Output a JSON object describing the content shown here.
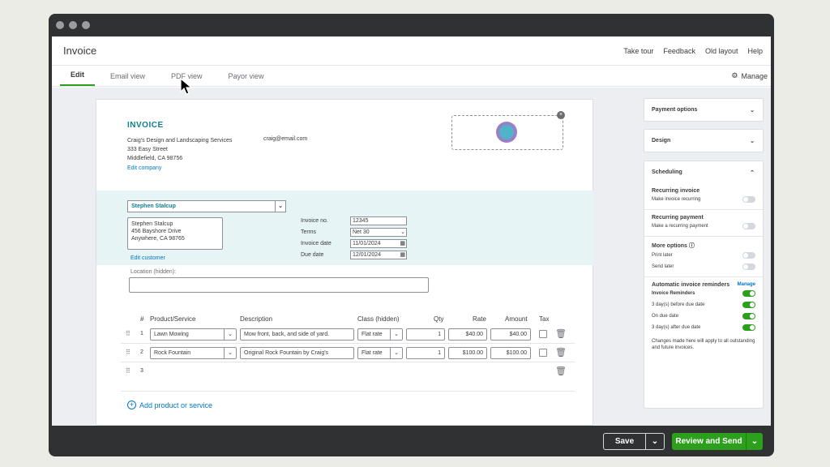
{
  "header": {
    "title": "Invoice",
    "links": [
      "Take tour",
      "Feedback",
      "Old layout",
      "Help"
    ]
  },
  "tabs": [
    "Edit",
    "Email view",
    "PDF view",
    "Payor view"
  ],
  "manage_label": "Manage",
  "invoice": {
    "heading": "INVOICE",
    "company_lines": [
      "Craig's Design and Landscaping Services",
      "333 Easy Street",
      "Middlefield, CA 98756"
    ],
    "email": "craig@email.com",
    "edit_company": "Edit company",
    "customer": "Stephen Stalcup",
    "billing_lines": [
      "Stephen Stalcup",
      "456 Bayshore Drive",
      "Anywhere, CA 98765"
    ],
    "edit_customer": "Edit customer",
    "meta": {
      "invoice_no_label": "Invoice no.",
      "invoice_no": "12345",
      "terms_label": "Terms",
      "terms": "Net 30",
      "invoice_date_label": "Invoice date",
      "invoice_date": "11/01/2024",
      "due_date_label": "Due date",
      "due_date": "12/01/2024"
    },
    "location_label": "Location (hidden):",
    "columns": [
      "#",
      "Product/Service",
      "Description",
      "Class (hidden)",
      "Qty",
      "Rate",
      "Amount",
      "Tax"
    ],
    "lines": [
      {
        "num": "1",
        "product": "Lawn Mowing",
        "description": "Mow front, back, and side of yard.",
        "class": "Flat rate",
        "qty": "1",
        "rate": "$40.00",
        "amount": "$40.00"
      },
      {
        "num": "2",
        "product": "Rock Fountain",
        "description": "Original Rock Fountain by Craig's",
        "class": "Flat rate",
        "qty": "1",
        "rate": "$100.00",
        "amount": "$100.00"
      },
      {
        "num": "3"
      }
    ],
    "add_line": "Add product or service"
  },
  "sidebar": {
    "payment_options": "Payment options",
    "design": "Design",
    "scheduling": "Scheduling",
    "recurring_invoice_title": "Recurring invoice",
    "recurring_invoice_toggle": "Make invoice recurring",
    "recurring_payment_title": "Recurring payment",
    "recurring_payment_toggle": "Make a recurring payment",
    "more_options_title": "More options",
    "print_later": "Print later",
    "send_later": "Send later",
    "reminders_title": "Automatic invoice reminders",
    "reminders_manage": "Manage",
    "reminders": [
      "Invoice Reminders",
      "3 day(s) before due date",
      "On due date",
      "3 day(s) after due date"
    ],
    "note": "Changes made here will apply to all outstanding and future invoices."
  },
  "footer": {
    "save": "Save",
    "review_send": "Review and Send"
  },
  "colors": {
    "accent": "#2ca01c",
    "link": "#0077c5",
    "title": "#0d7f8c"
  }
}
